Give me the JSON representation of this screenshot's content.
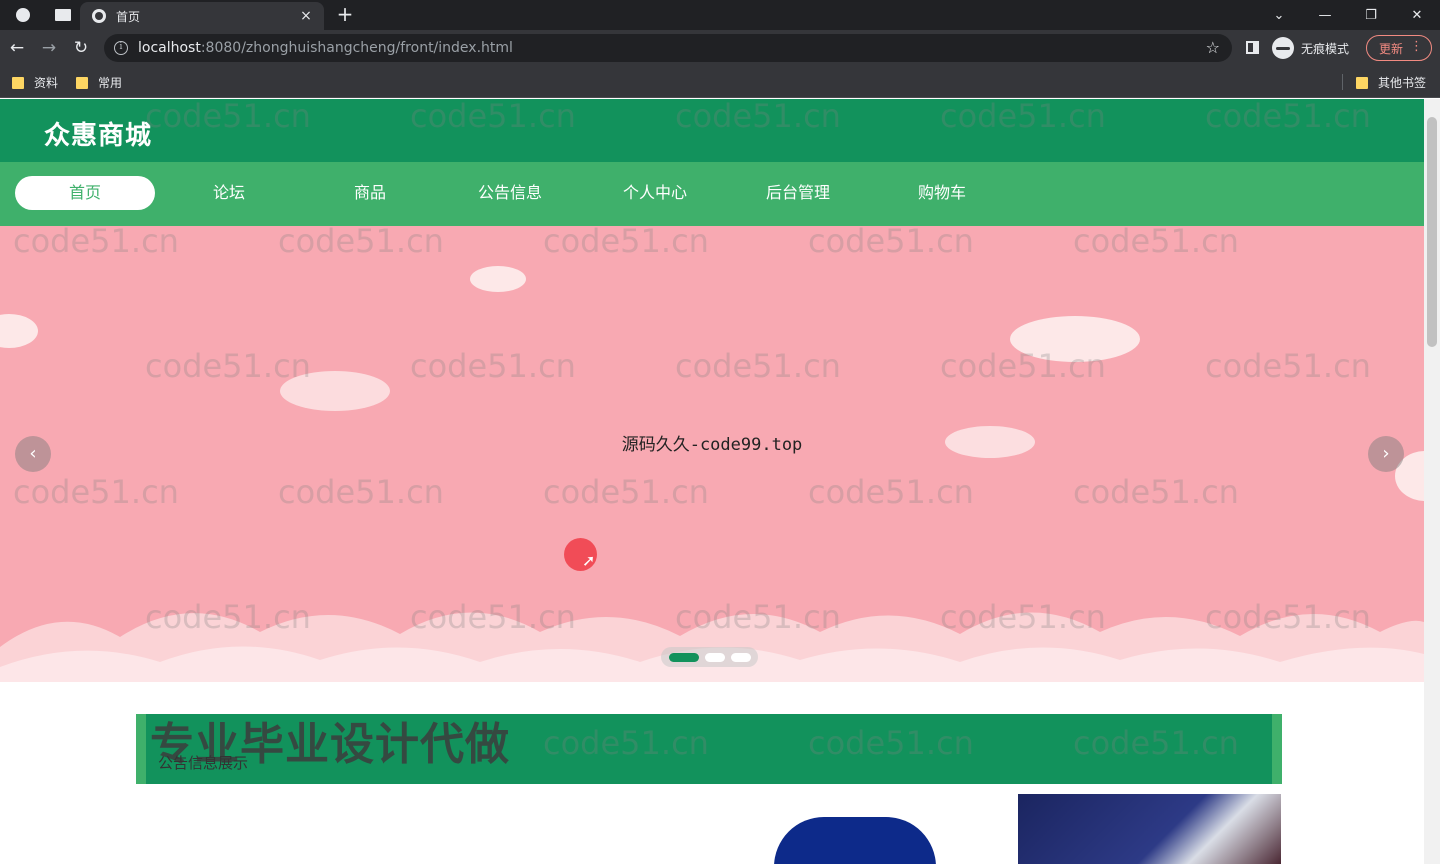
{
  "browser": {
    "tab_title": "首页",
    "tab_close": "×",
    "new_tab": "+",
    "url_host": "localhost",
    "url_path": ":8080/zhonghuishangcheng/front/index.html",
    "incognito_label": "无痕模式",
    "update_label": "更新",
    "bookmarks": [
      "资料",
      "常用"
    ],
    "other_bookmarks": "其他书签"
  },
  "site": {
    "title": "众惠商城"
  },
  "nav": {
    "items": [
      {
        "label": "首页",
        "active": true
      },
      {
        "label": "论坛",
        "active": false
      },
      {
        "label": "商品",
        "active": false
      },
      {
        "label": "公告信息",
        "active": false
      },
      {
        "label": "个人中心",
        "active": false
      },
      {
        "label": "后台管理",
        "active": false
      },
      {
        "label": "购物车",
        "active": false
      }
    ]
  },
  "carousel": {
    "caption": "源码久久-code99.top",
    "prev_icon": "‹",
    "next_icon": "›",
    "slide_count": 3,
    "active_index": 0
  },
  "section": {
    "overlay_text": "专业毕业设计代做",
    "subtitle": "公告信息展示"
  },
  "watermark_text": "code51.cn",
  "colors": {
    "header_green": "#12925c",
    "nav_green": "#3fb06b",
    "banner_pink": "#f8a9b2"
  }
}
